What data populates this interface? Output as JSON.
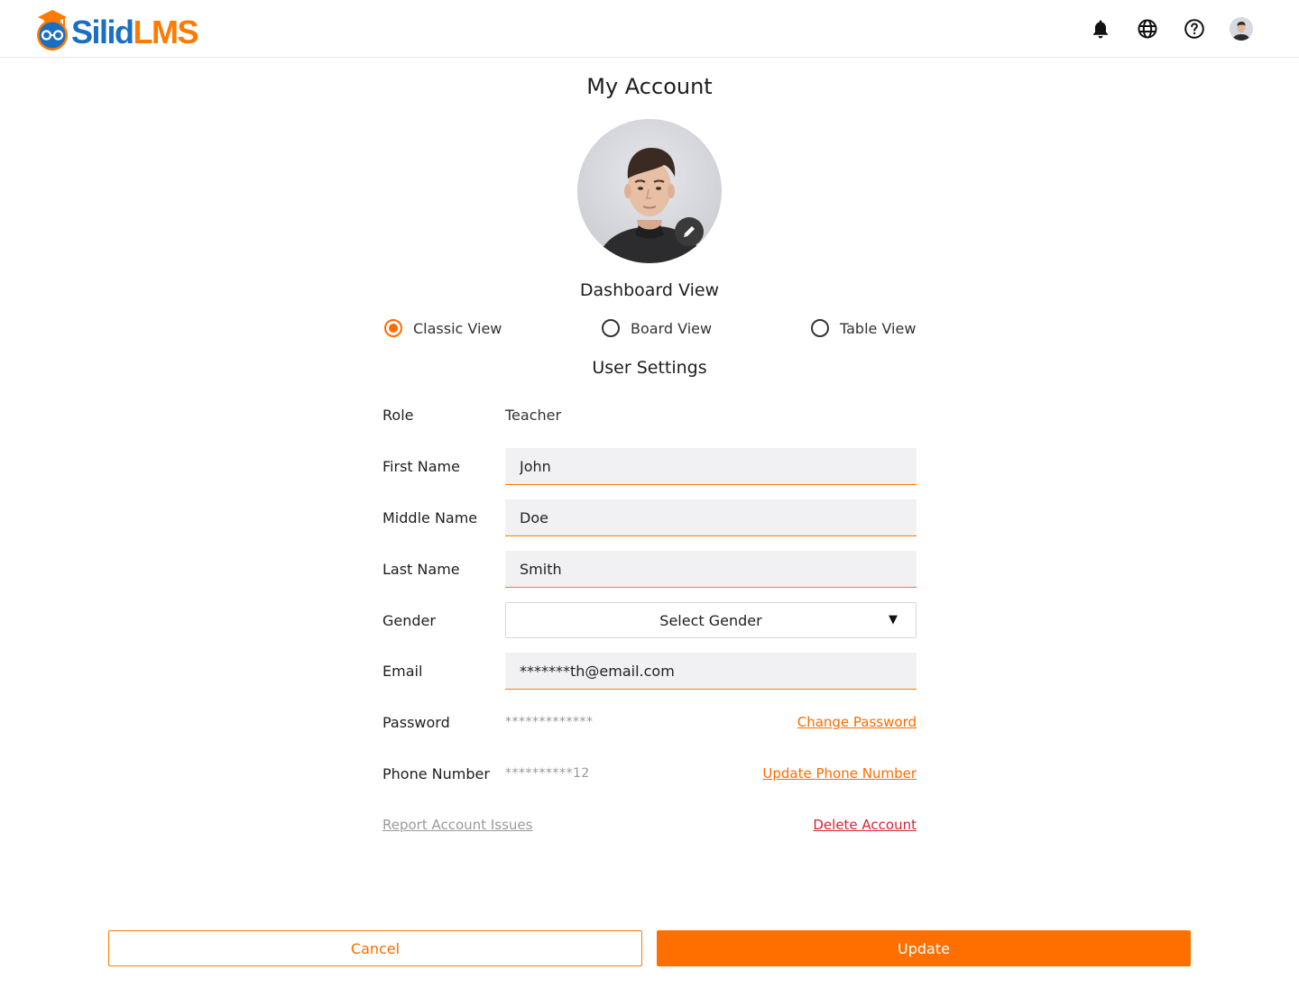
{
  "header": {
    "logo": {
      "part1": "Silid",
      "part2": "LMS"
    },
    "icons": [
      "bell-icon",
      "globe-icon",
      "help-icon",
      "avatar"
    ]
  },
  "page": {
    "title": "My Account"
  },
  "dashboard": {
    "title": "Dashboard View",
    "options": [
      {
        "label": "Classic View",
        "checked": true
      },
      {
        "label": "Board View",
        "checked": false
      },
      {
        "label": "Table View",
        "checked": false
      }
    ]
  },
  "settings": {
    "title": "User Settings",
    "role": {
      "label": "Role",
      "value": "Teacher"
    },
    "first_name": {
      "label": "First Name",
      "value": "John"
    },
    "middle_name": {
      "label": "Middle Name",
      "value": "Doe"
    },
    "last_name": {
      "label": "Last Name",
      "value": "Smith"
    },
    "gender": {
      "label": "Gender",
      "value": "Select Gender"
    },
    "email": {
      "label": "Email",
      "value": "*******th@email.com"
    },
    "password": {
      "label": "Password",
      "value": "*************",
      "action": "Change Password"
    },
    "phone": {
      "label": "Phone Number",
      "value": "**********12",
      "action": "Update Phone Number"
    },
    "report": "Report Account Issues",
    "delete": "Delete Account"
  },
  "actions": {
    "cancel": "Cancel",
    "update": "Update"
  },
  "colors": {
    "accent": "#ff6f00",
    "brand_blue": "#1b6fc2",
    "danger": "#d6242b"
  }
}
